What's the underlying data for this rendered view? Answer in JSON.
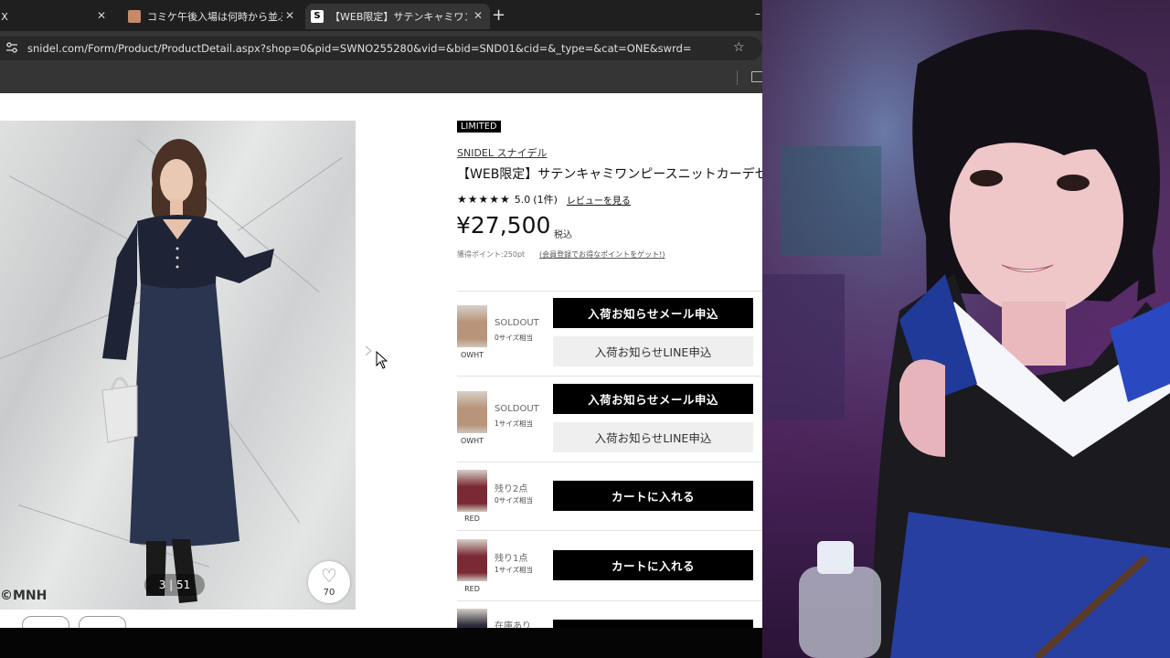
{
  "browser": {
    "tabs": [
      {
        "title": "/ X",
        "close": "✕"
      },
      {
        "title": "コミケ午後入場は何時から並ぶ？",
        "close": "✕"
      },
      {
        "title": "【WEB限定】サテンキャミワンピースニ",
        "close": "✕",
        "favicon_letter": "S"
      }
    ],
    "new_tab": "+",
    "minimize": "–",
    "url": "snidel.com/Form/Product/ProductDetail.aspx?shop=0&pid=SWNO255280&vid=&bid=SND01&cid=&_type=&cat=ONE&swrd=",
    "icons": [
      "site-settings-icon",
      "star-icon",
      "folder-icon",
      "close-icon",
      "heart-icon",
      "chevron-right-icon",
      "cursor-icon"
    ]
  },
  "product": {
    "badge": "LIMITED",
    "brand": "SNIDEL スナイデル",
    "title": "【WEB限定】サテンキャミワンピースニットカーデセット",
    "stars": "★★★★★",
    "rating": "5.0",
    "review_count": "(1件)",
    "review_link": "レビューを見る",
    "price": "¥27,500",
    "tax": "税込",
    "points": "獲得ポイント:250pt",
    "points_link": "(会員登録でお得なポイントをゲット!)",
    "photo_counter": "3 | 51",
    "watermark": "©MNH",
    "likes": "70",
    "heart": "♡",
    "next_arrow": "›"
  },
  "variants": [
    {
      "color": "OWHT",
      "status": "SOLDOUT",
      "size": "0サイズ相当",
      "button1": "入荷お知らせメール申込",
      "button2": "入荷お知らせLINE申込",
      "swatch": "#b8957a"
    },
    {
      "color": "OWHT",
      "status": "SOLDOUT",
      "size": "1サイズ相当",
      "button1": "入荷お知らせメール申込",
      "button2": "入荷お知らせLINE申込",
      "swatch": "#b8957a"
    },
    {
      "color": "RED",
      "status": "残り2点",
      "size": "0サイズ相当",
      "button1": "カートに入れる",
      "swatch": "#7a2a35"
    },
    {
      "color": "RED",
      "status": "残り1点",
      "size": "1サイズ相当",
      "button1": "カートに入れる",
      "swatch": "#7a2a35"
    },
    {
      "color": "",
      "status": "在庫あり",
      "size": "",
      "button1": "",
      "swatch": "#2a2a3a"
    }
  ],
  "colors": {
    "tabbar": "#1f1f1f",
    "toolbar": "#353535",
    "accent_black": "#000000",
    "dress_navy": "#2b3550"
  }
}
